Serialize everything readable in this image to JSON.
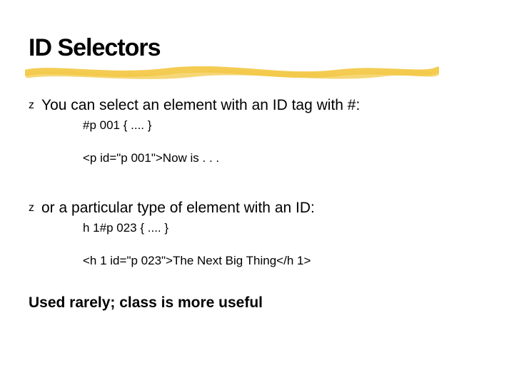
{
  "title": "ID Selectors",
  "bullets": [
    {
      "text": "You can select an element with an ID tag with #:",
      "subs": [
        "#p 001 { .... }",
        "<p id=\"p 001\">Now is . . ."
      ]
    },
    {
      "text": "or a particular type of element with an ID:",
      "subs": [
        "h 1#p 023 { .... }",
        "<h 1 id=\"p 023\">The Next Big Thing</h 1>"
      ]
    }
  ],
  "footer": "Used rarely; class is more useful",
  "bullet_glyph": "z",
  "colors": {
    "highlight": "#f3c94a"
  }
}
